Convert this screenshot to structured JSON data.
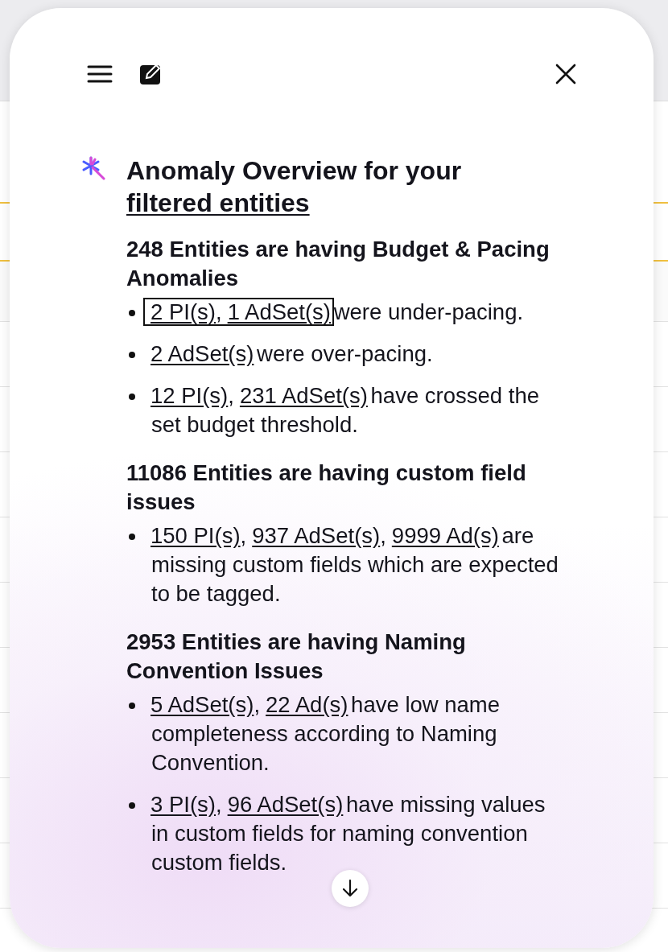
{
  "panel": {
    "title": "Anomaly Overview for your",
    "title_link": "filtered entities",
    "sections": [
      {
        "heading": "248 Entities are having Budget & Pacing Anomalies",
        "bullets": [
          {
            "focused": true,
            "refs": [
              {
                "text": "2 PI(s)",
                "suffix": ","
              },
              {
                "text": "1 AdSet(s)"
              }
            ],
            "text": "were under-pacing."
          },
          {
            "focused": false,
            "refs": [
              {
                "text": "2 AdSet(s)"
              }
            ],
            "text": "were over-pacing."
          },
          {
            "focused": false,
            "refs": [
              {
                "text": "12 PI(s)",
                "suffix": ","
              },
              {
                "text": "231 AdSet(s)"
              }
            ],
            "text": "have crossed the set budget threshold."
          }
        ]
      },
      {
        "heading": "11086 Entities are having custom field issues",
        "bullets": [
          {
            "focused": false,
            "refs": [
              {
                "text": "150 PI(s)",
                "suffix": ","
              },
              {
                "text": "937 AdSet(s)",
                "suffix": ","
              },
              {
                "text": "9999 Ad(s)"
              }
            ],
            "text": "are missing custom fields which are expected to be tagged."
          }
        ]
      },
      {
        "heading": "2953 Entities are having Naming Convention Issues",
        "bullets": [
          {
            "focused": false,
            "refs": [
              {
                "text": "5 AdSet(s)",
                "suffix": ","
              },
              {
                "text": "22 Ad(s)"
              }
            ],
            "text": "have low name completeness according to Naming Convention."
          },
          {
            "focused": false,
            "refs": [
              {
                "text": "3 PI(s)",
                "suffix": ","
              },
              {
                "text": "96 AdSet(s)"
              }
            ],
            "text": "have missing values in custom fields for naming convention custom fields."
          }
        ]
      }
    ]
  }
}
